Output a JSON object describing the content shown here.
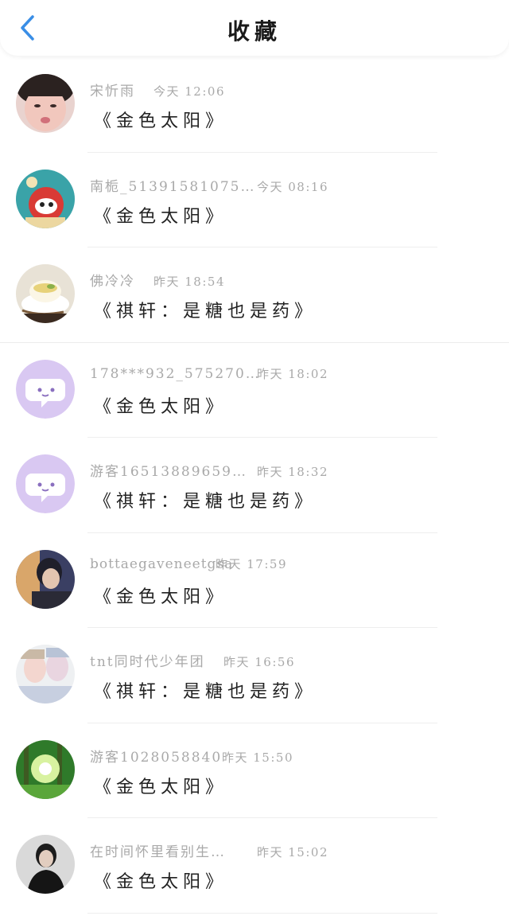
{
  "header": {
    "title": "收藏",
    "back_icon": "chevron-left-icon",
    "accent": "#3a8ee6"
  },
  "items": [
    {
      "name": "宋忻雨",
      "time": "今天 12:06",
      "message": "《金色太阳》",
      "avatar": "photo-avatar"
    },
    {
      "name": "南栀_51391581075…",
      "time": "今天 08:16",
      "message": "《金色太阳》",
      "avatar": "cartoon-avatar"
    },
    {
      "name": "佛冷冷",
      "time": "昨天 18:54",
      "message": "《祺轩：是糖也是药》",
      "avatar": "food-avatar"
    },
    {
      "name": "178***932_575270…",
      "time": "昨天 18:02",
      "message": "《金色太阳》",
      "avatar": "chat-bubble-icon"
    },
    {
      "name": "游客16513889659…",
      "time": "昨天 18:32",
      "message": "《祺轩：是糖也是药》",
      "avatar": "chat-bubble-icon"
    },
    {
      "name": "bottaegaveneetgsa",
      "time": "昨天 17:59",
      "message": "《金色太阳》",
      "avatar": "photo-avatar"
    },
    {
      "name": "tnt同时代少年团",
      "time": "昨天 16:56",
      "message": "《祺轩：是糖也是药》",
      "avatar": "photo-avatar"
    },
    {
      "name": "游客1028058840",
      "time": "昨天 15:50",
      "message": "《金色太阳》",
      "avatar": "forest-avatar"
    },
    {
      "name": "在时间怀里看别生…",
      "time": "昨天 15:02",
      "message": "《金色太阳》",
      "avatar": "photo-avatar"
    }
  ]
}
